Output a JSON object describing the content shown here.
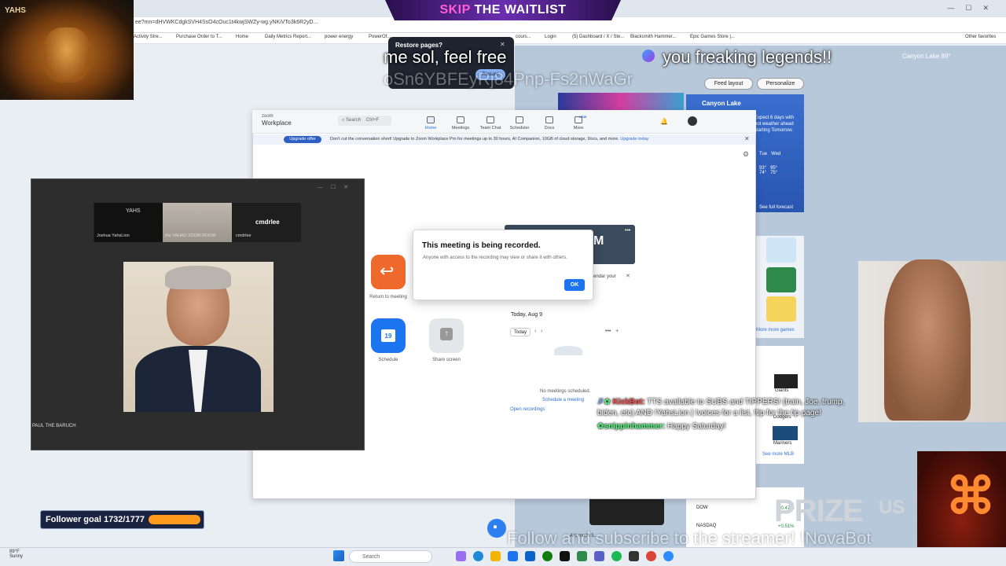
{
  "browser": {
    "address": "ee?mn=dHVWKCdgkSVH4SsO4cOuc1t4kwjSWZy-wg.yNKiVTo3k6R2yD...",
    "bookmarks": [
      "Activity Stre...",
      "Purchase Order to T...",
      "Home",
      "Daily Metrics Report...",
      "power energy",
      "PowerOf...",
      "cours...",
      "Login",
      "(5) Dashboard / X / Ste...",
      "Blacksmith Hammer...",
      "Epic Games Store |...",
      "Other favorites"
    ]
  },
  "skip_banner": {
    "skip": "SKIP",
    "rest": "THE WAITLIST"
  },
  "restore": {
    "title": "Restore pages?",
    "button": "Restore"
  },
  "ghost_chat": {
    "line1a": "me sol, feel free",
    "line1b": "you freaking legends!!",
    "line2": "oSn6YBFEyRj84Pnp-Fs2nWaGr"
  },
  "msn": {
    "location": "Canyon Lake",
    "temp": "89°",
    "feed_layout": "Feed layout",
    "personalize": "Personalize",
    "weather_title": "Canyon Lake",
    "weather_text": "Expect 6 days with hot weather ahead starting Tomorrow.",
    "days": [
      "Tue",
      "Wed"
    ],
    "highs": [
      "93°",
      "95°"
    ],
    "lows": [
      "74°",
      "75°"
    ],
    "full_forecast": "See full forecast",
    "more_games": "More more games",
    "teams": [
      "Giants",
      "Dodgers",
      "Mariners"
    ],
    "more_mlb": "See more MLB",
    "stocks": [
      {
        "name": "DOW",
        "change": "+0.47%"
      },
      {
        "name": "NASDAQ",
        "change": "+0.51%"
      }
    ],
    "article": "Are much 5..."
  },
  "zoom": {
    "logo_top": "zoom",
    "logo_bottom": "Workplace",
    "search": "Search",
    "shortcut": "Ctrl+F",
    "tabs": [
      "Home",
      "Meetings",
      "Team Chat",
      "Scheduler",
      "Docs",
      "More"
    ],
    "new_badge": "NEW",
    "upgrade_badge": "Upgrade offer",
    "upgrade_text": "Don't cut the conversation short! Upgrade to Zoom Workplace Pro for meetings up to 30 hours, AI Companion, 10GB of cloud storage, Docs, and more.",
    "upgrade_link": "Upgrade today",
    "return_label": "Return to meeting",
    "schedule_label": "Schedule",
    "share_label": "Share screen",
    "calendar_day": "19",
    "dialog_title": "This meeting is being recorded.",
    "dialog_body": "Anyone with access to the recording may view or share it with others.",
    "dialog_ok": "OK",
    "today": "Today, Aug 9",
    "today_btn": "Today",
    "no_meetings": "No meetings scheduled.",
    "open_recordings": "Open recordings",
    "schedule_meeting": "Schedule a meeting",
    "card_text": "endar your"
  },
  "video": {
    "participants": [
      {
        "name": "Joshua YahsLion",
        "tag": "YAHS"
      },
      {
        "name": "the YAHAD ZOOM ROOM",
        "tag": ""
      },
      {
        "name": "cmdrlee",
        "tag": "cmdrlee"
      }
    ],
    "speaker": "PAUL THE BARUCH"
  },
  "chat": {
    "bot_name": "KickBot:",
    "bot_msg": "TTS available to SUBS and TIPPERS! (train, Joe, trump, biden, etc) AND !YahsLion | !voices for a list, !tip for the tip page!",
    "user_name": "snippinhammer:",
    "user_msg": "Happy Saturday!"
  },
  "overlay": {
    "prize": "PRIZE",
    "prize_us": "US",
    "novabot": "Follow and subscribe to the streamer! !NovaBot",
    "follower_goal": "Follower goal 1732/1777",
    "follower_progress": 0.975
  },
  "taskbar": {
    "weather_temp": "89°F",
    "weather_cond": "Sunny",
    "search": "Search"
  }
}
